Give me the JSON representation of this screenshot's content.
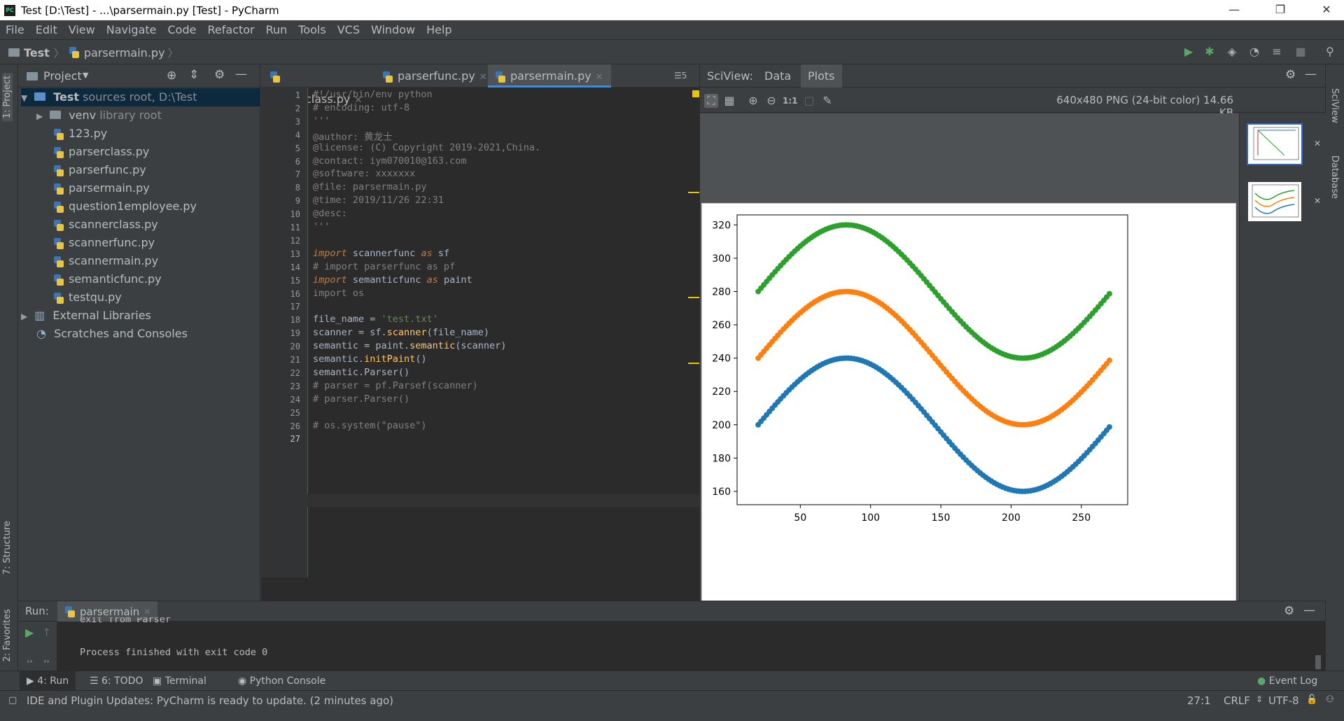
{
  "window": {
    "title": "Test [D:\\Test] - ...\\parsermain.py [Test] - PyCharm",
    "logo": "PC",
    "minimize": "—",
    "restore": "❐",
    "close": "✕"
  },
  "menu": [
    "File",
    "Edit",
    "View",
    "Navigate",
    "Code",
    "Refactor",
    "Run",
    "Tools",
    "VCS",
    "Window",
    "Help"
  ],
  "breadcrumb": {
    "project": "Test",
    "file": "parsermain.py"
  },
  "toolbar": {
    "run_config": "parsermain"
  },
  "left_strip": {
    "project_tab": "1: Project",
    "structure_tab": "7: Structure",
    "favorites_tab": "2: Favorites"
  },
  "right_strip": {
    "sciview_tab": "SciView",
    "database_tab": "Database"
  },
  "project_panel": {
    "title": "Project",
    "root": {
      "name": "Test",
      "note": "sources root,",
      "path": "D:\\Test"
    },
    "venv": {
      "name": "venv",
      "note": "library root"
    },
    "files": [
      "123.py",
      "parserclass.py",
      "parserfunc.py",
      "parsermain.py",
      "question1employee.py",
      "scannerclass.py",
      "scannerfunc.py",
      "scannermain.py",
      "semanticfunc.py",
      "testqu.py"
    ],
    "external": "External Libraries",
    "scratches": "Scratches and Consoles"
  },
  "editor": {
    "tabs": [
      "parserclass.py",
      "parserfunc.py",
      "parsermain.py"
    ],
    "active_tab": "parsermain.py",
    "tab_count_label": "5",
    "lines": [
      [
        {
          "t": "#!/usr/bin/env python",
          "c": "com"
        }
      ],
      [
        {
          "t": "# encoding: utf-8",
          "c": "com"
        }
      ],
      [
        {
          "t": "'''",
          "c": "com"
        }
      ],
      [
        {
          "t": "@author: 黄龙士",
          "c": "com"
        }
      ],
      [
        {
          "t": "@license: (C) Copyright 2019-2021,China.",
          "c": "com"
        }
      ],
      [
        {
          "t": "@contact: iym070010@163.com",
          "c": "com"
        }
      ],
      [
        {
          "t": "@software: xxxxxxx",
          "c": "com"
        }
      ],
      [
        {
          "t": "@file: parsermain.py",
          "c": "com"
        }
      ],
      [
        {
          "t": "@time: 2019/11/26 22:31",
          "c": "com"
        }
      ],
      [
        {
          "t": "@desc:",
          "c": "com"
        }
      ],
      [
        {
          "t": "'''",
          "c": "com"
        }
      ],
      [
        {
          "t": "",
          "c": ""
        }
      ],
      [
        {
          "t": "import",
          "c": "kwi"
        },
        {
          "t": " scannerfunc ",
          "c": ""
        },
        {
          "t": "as",
          "c": "kwi"
        },
        {
          "t": " sf",
          "c": ""
        }
      ],
      [
        {
          "t": "# import parserfunc as pf",
          "c": "com"
        }
      ],
      [
        {
          "t": "import",
          "c": "kwi"
        },
        {
          "t": " semanticfunc ",
          "c": ""
        },
        {
          "t": "as",
          "c": "kwi"
        },
        {
          "t": " paint",
          "c": ""
        }
      ],
      [
        {
          "t": "import os",
          "c": "com"
        }
      ],
      [
        {
          "t": "",
          "c": ""
        }
      ],
      [
        {
          "t": "file_name = ",
          "c": ""
        },
        {
          "t": "'test.txt'",
          "c": "str"
        }
      ],
      [
        {
          "t": "scanner = sf.",
          "c": ""
        },
        {
          "t": "scanner",
          "c": "fn"
        },
        {
          "t": "(file_name)",
          "c": ""
        }
      ],
      [
        {
          "t": "semantic = paint.",
          "c": ""
        },
        {
          "t": "semantic",
          "c": "fn"
        },
        {
          "t": "(scanner)",
          "c": ""
        }
      ],
      [
        {
          "t": "semantic.",
          "c": ""
        },
        {
          "t": "initPaint",
          "c": "fn"
        },
        {
          "t": "()",
          "c": ""
        }
      ],
      [
        {
          "t": "semantic.Parser()",
          "c": ""
        }
      ],
      [
        {
          "t": "# parser = pf.Parsef(scanner)",
          "c": "com"
        }
      ],
      [
        {
          "t": "# parser.Parser()",
          "c": "com"
        }
      ],
      [
        {
          "t": "",
          "c": ""
        }
      ],
      [
        {
          "t": "# os.system(\"pause\")",
          "c": "com"
        }
      ],
      [
        {
          "t": "",
          "c": ""
        }
      ]
    ]
  },
  "sciview": {
    "label": "SciView:",
    "tabs": [
      "Data",
      "Plots"
    ],
    "active_tab": "Plots",
    "image_info": "640x480 PNG (24-bit color) 14.66 KB",
    "zoom_actual_label": "1:1"
  },
  "chart_data": {
    "type": "scatter",
    "x_ticks": [
      50,
      100,
      150,
      200,
      250
    ],
    "y_ticks": [
      160,
      180,
      200,
      220,
      240,
      260,
      280,
      300,
      320
    ],
    "xlim": [
      5,
      283
    ],
    "ylim": [
      152,
      326
    ],
    "x_range": [
      20,
      270
    ],
    "step": 2,
    "series": [
      {
        "formula": "200 + 40*sin((x-20)/40)",
        "color": "#1f77b4"
      },
      {
        "formula": "240 + 40*sin((x-20)/40)",
        "color": "#ff7f0e"
      },
      {
        "formula": "280 + 40*sin((x-20)/40)",
        "color": "#2ca02c"
      }
    ]
  },
  "run": {
    "label": "Run:",
    "config": "parsermain",
    "output_partial": "exit from Parser",
    "output": "Process finished with exit code 0"
  },
  "bottom_tabs": [
    "4: Run",
    "6: TODO",
    "Terminal",
    "Python Console"
  ],
  "event_log": "Event Log",
  "status": {
    "message": "IDE and Plugin Updates: PyCharm is ready to update. (2 minutes ago)",
    "position": "27:1",
    "line_sep": "CRLF",
    "encoding": "UTF-8"
  }
}
